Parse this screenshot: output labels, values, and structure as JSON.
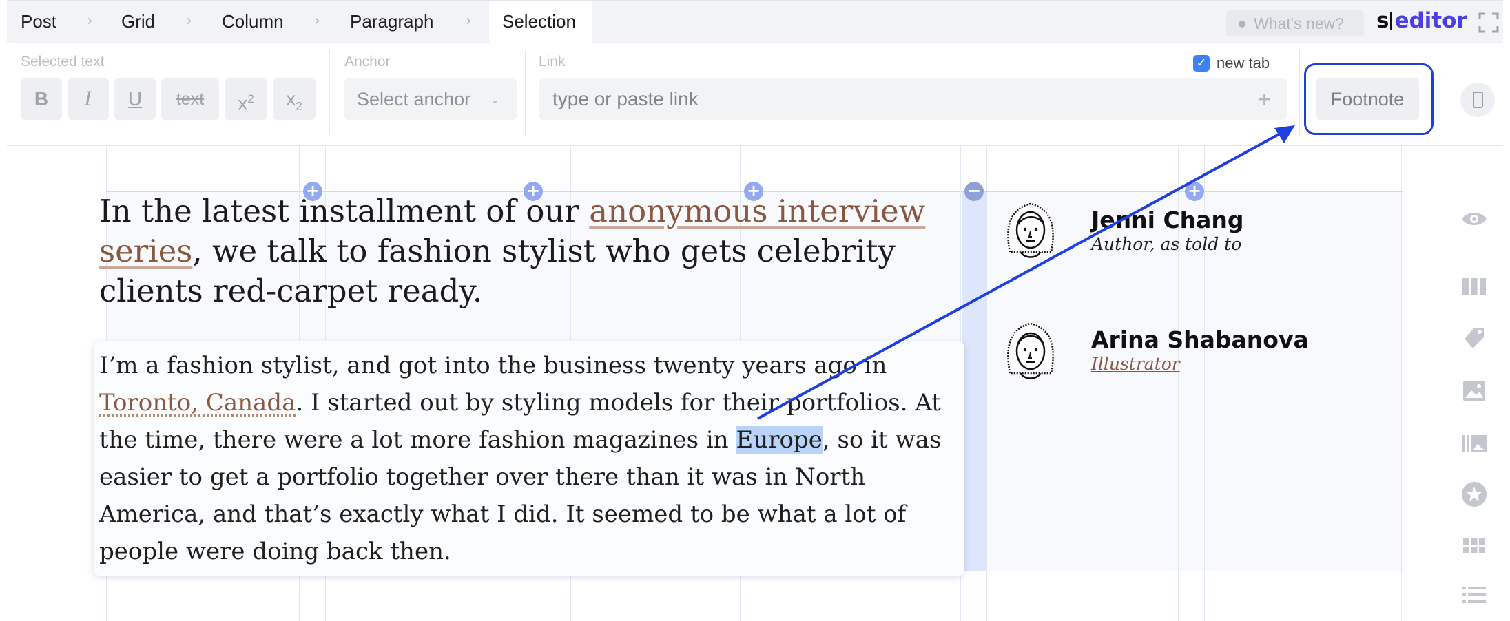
{
  "breadcrumb": {
    "items": [
      "Post",
      "Grid",
      "Column",
      "Paragraph",
      "Selection"
    ],
    "active": "Selection"
  },
  "header": {
    "whats_new": "What's new?",
    "logo_prefix": "s",
    "logo_suffix": "editor"
  },
  "toolbar": {
    "selected_text_label": "Selected text",
    "anchor_label": "Anchor",
    "link_label": "Link",
    "format_buttons": {
      "bold": "B",
      "italic": "I",
      "underline": "U",
      "strike": "text",
      "superscript_base": "x",
      "superscript_exp": "2",
      "subscript_base": "x",
      "subscript_exp": "2"
    },
    "anchor_select": "Select anchor",
    "link_placeholder": "type or paste link",
    "link_add": "+",
    "new_tab_label": "new tab",
    "new_tab_checked": true,
    "footnote_label": "Footnote"
  },
  "content": {
    "intro": {
      "before": "In the latest installment of our ",
      "link": "anonymous interview series",
      "after": ", we talk to fashion stylist who gets celebrity clients red-carpet ready."
    },
    "paragraph": {
      "part1": "I’m a fashion stylist, and got into the business twenty years ago in ",
      "link": "Toronto, Canada",
      "part2": ". I started out by styling models for their portfolios. At the time, there were a lot more fashion magazines in ",
      "selected": "Europe",
      "part3": ", so it was easier to get a portfolio together over there than it was in North America, and that’s exactly what I did. It seemed to be what a lot of people were doing back then."
    }
  },
  "authors": [
    {
      "name": "Jenni Chang",
      "role": "Author, as told to"
    },
    {
      "name": "Arina Shabanova",
      "role": "Illustrator"
    }
  ],
  "grid_controls": {
    "add": "+",
    "remove": "−"
  },
  "sidebar_icons": [
    "eye-icon",
    "columns-icon",
    "tags-icon",
    "image-icon",
    "gallery-icon",
    "star-icon",
    "grid-icon",
    "list-icon"
  ],
  "colors": {
    "accent": "#1f3fe0",
    "link": "#8a5741",
    "selection": "#b9d4f8",
    "brand": "#4c3ee8"
  }
}
